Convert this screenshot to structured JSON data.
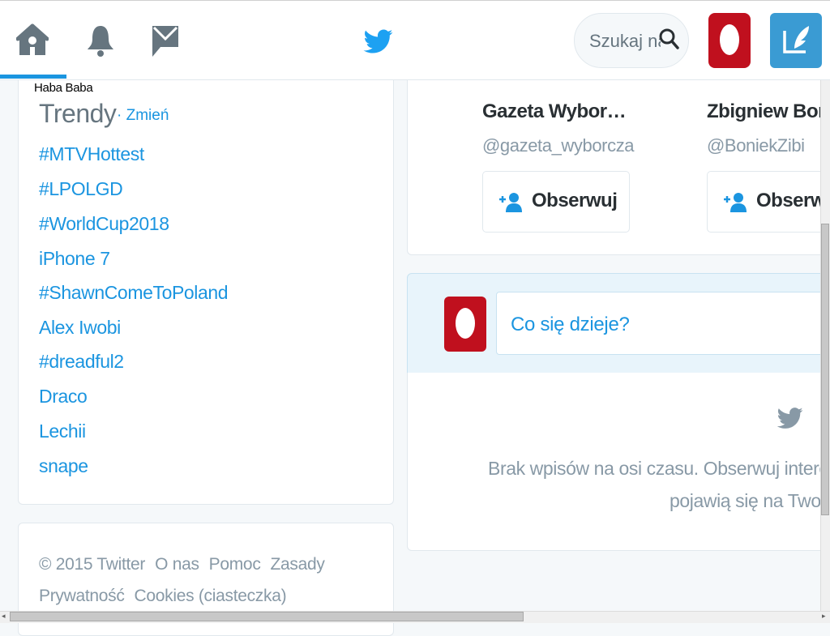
{
  "header": {
    "search_placeholder": "Szukaj na Twitterze"
  },
  "tooltip": "Haba Baba",
  "trends": {
    "title": "Trendy",
    "change_link": "· Zmień",
    "items": [
      "#MTVHottest",
      "#LPOLGD",
      "#WorldCup2018",
      "iPhone 7",
      "#ShawnComeToPoland",
      "Alex Iwobi",
      "#dreadful2",
      "Draco",
      "Lechii",
      "snape"
    ]
  },
  "footer": {
    "line1": [
      "© 2015 Twitter",
      "O nas",
      "Pomoc",
      "Zasady"
    ],
    "line2": [
      "Prywatność",
      "Cookies (ciasteczka)"
    ]
  },
  "who_to_follow": [
    {
      "name": "Gazeta Wybor…",
      "handle": "@gazeta_wyborcza",
      "button": "Obserwuj"
    },
    {
      "name": "Zbigniew Bon",
      "handle": "@BoniekZibi",
      "button": "Obserwuj"
    }
  ],
  "compose": {
    "placeholder": "Co się dzieje?"
  },
  "timeline": {
    "empty_line1": "Brak wpisów na osi czasu. Obserwuj interesujące Cię konta",
    "empty_line2": "pojawią się na Twojej osi czasu."
  },
  "colors": {
    "accent": "#1b95e0",
    "avatar_red": "#c0101e",
    "tweet_button": "#3a9bd3"
  },
  "icons": {
    "home": "home-icon",
    "notifications": "bell-icon",
    "messages": "mail-icon",
    "logo": "twitter-bird-icon",
    "search": "search-icon",
    "tweet": "compose-tweet-icon",
    "follow": "add-user-icon"
  }
}
